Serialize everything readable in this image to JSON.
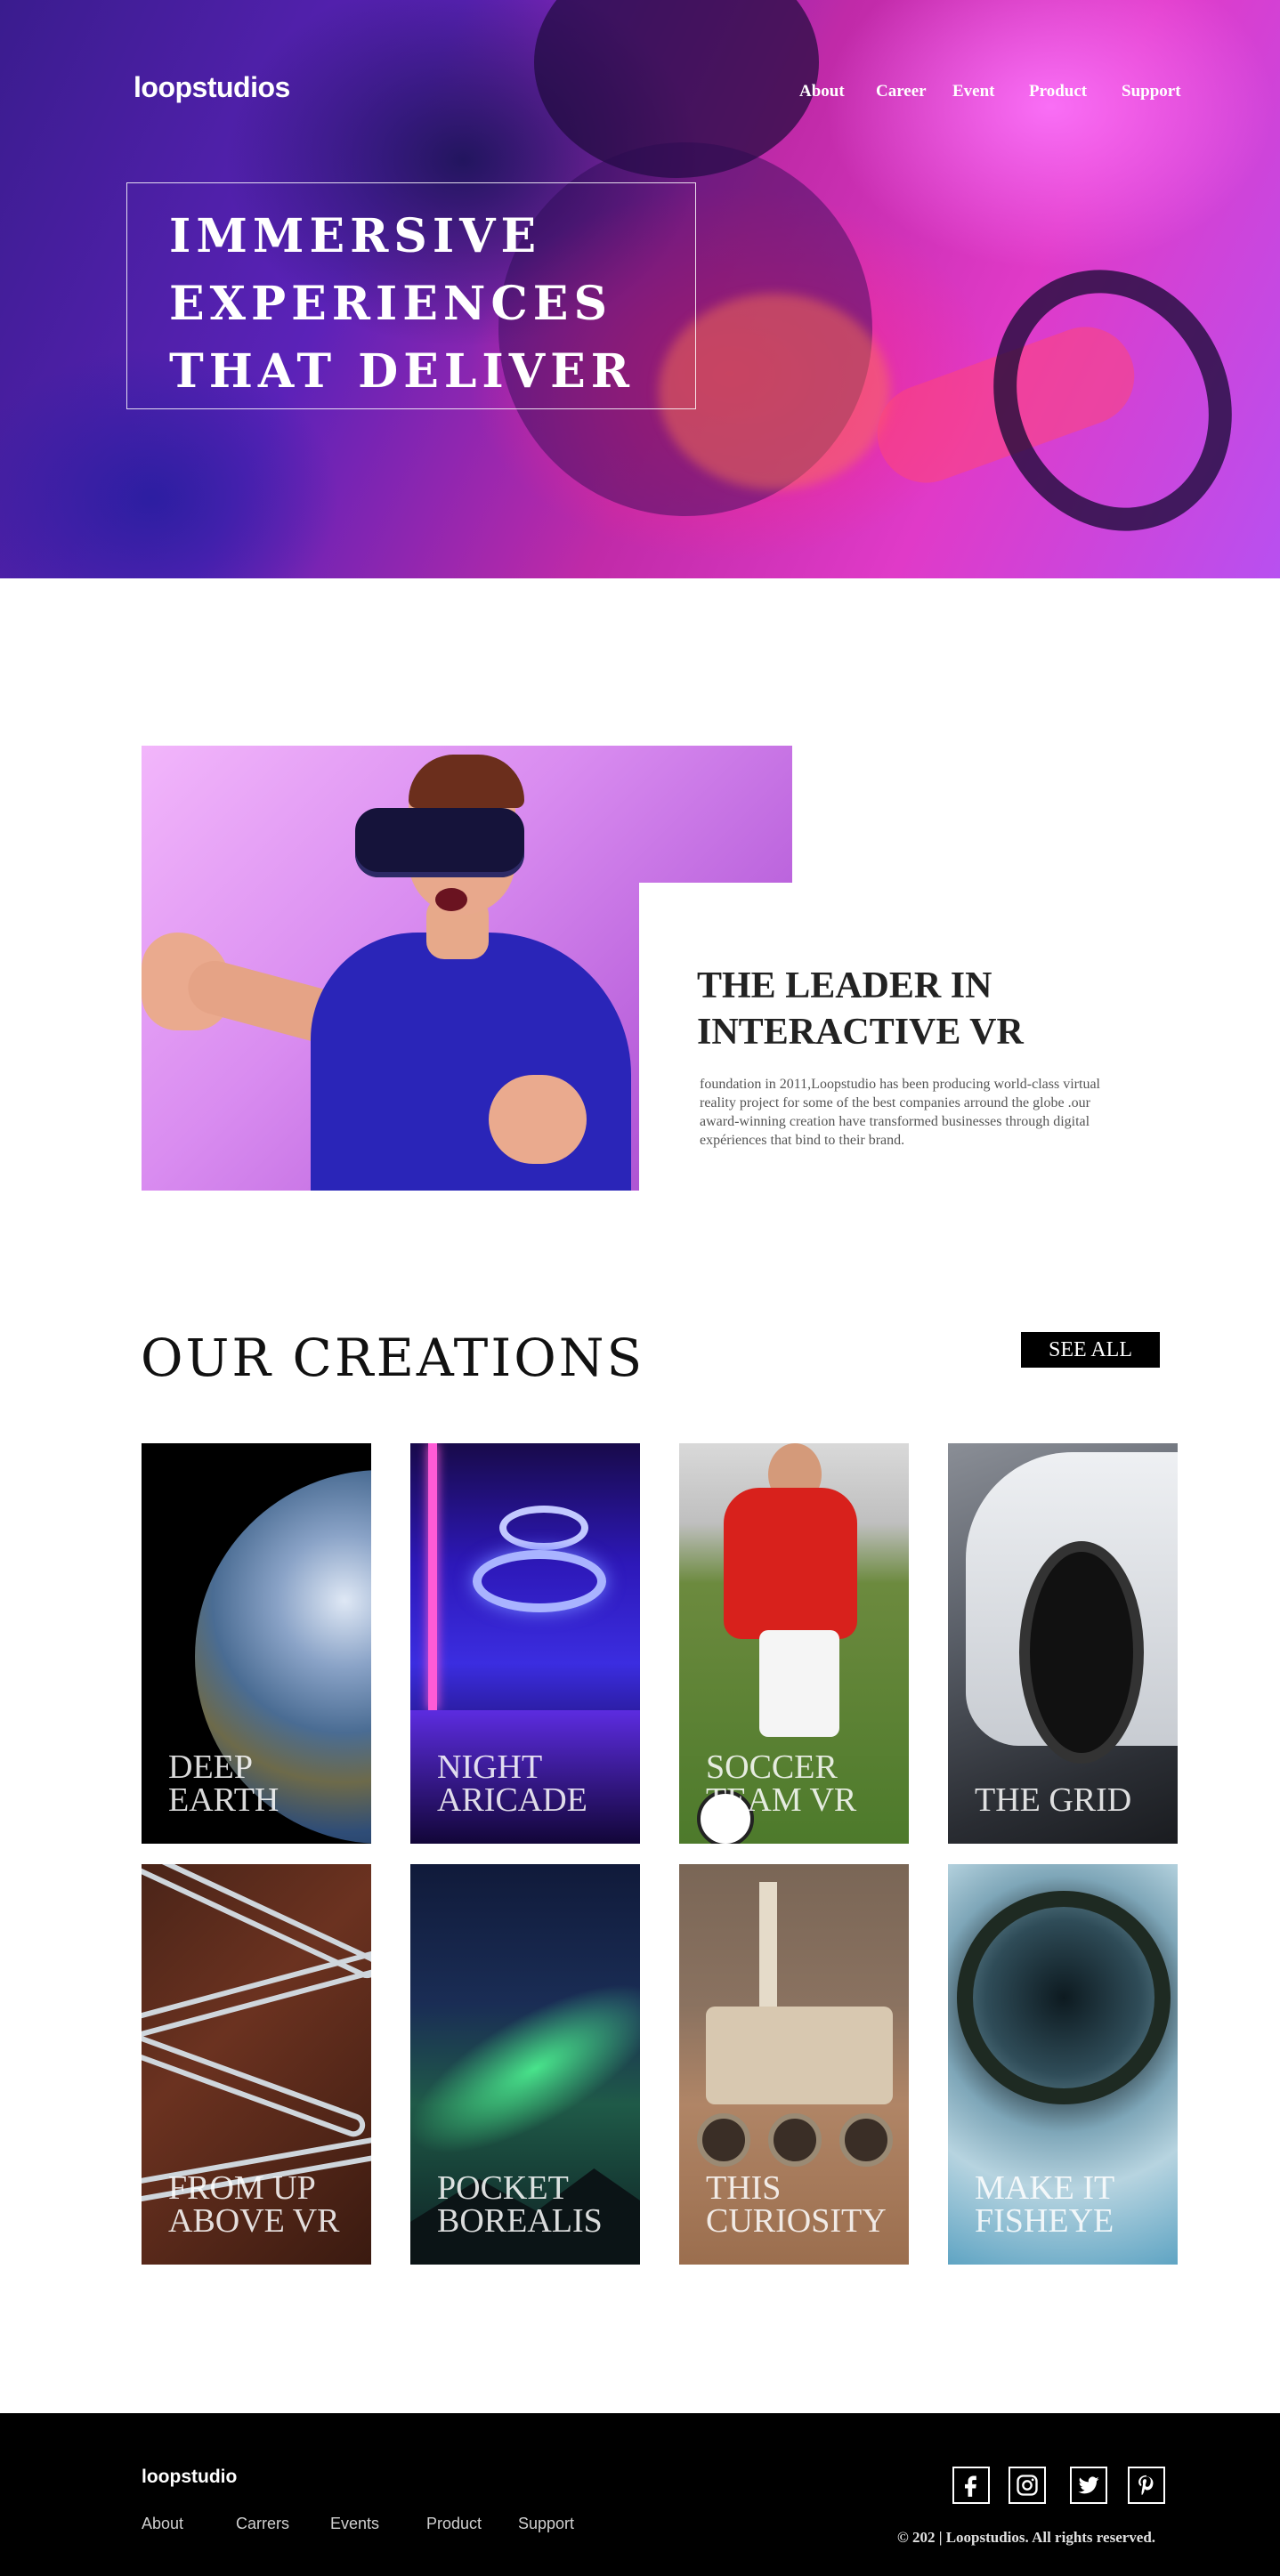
{
  "brand": {
    "logo": "loopstudios"
  },
  "nav": {
    "items": [
      "About",
      "Career",
      "Event",
      "Product",
      "Support"
    ]
  },
  "hero": {
    "title_lines": [
      "IMMERSIVE",
      "EXPERIENCES",
      "THAT DELIVER"
    ]
  },
  "about": {
    "title": "THE LEADER IN INTERACTIVE VR",
    "text": "foundation in 2011,Loopstudio has been producing world-class virtual reality project for some of the best companies arround the globe .our award-winning creation have transformed businesses through digital expériences that bind to their brand."
  },
  "creations": {
    "title": "OUR CREATIONS",
    "see_all": "SEE ALL",
    "cards": [
      {
        "label": "DEEP EARTH"
      },
      {
        "label": "NIGHT ARICADE"
      },
      {
        "label": "SOCCER TEAM VR"
      },
      {
        "label": "THE GRID"
      },
      {
        "label": "FROM UP ABOVE VR"
      },
      {
        "label": "POCKET BOREALIS"
      },
      {
        "label": "THIS CURIOSITY"
      },
      {
        "label": "MAKE IT FISHEYE"
      }
    ]
  },
  "footer": {
    "logo": "loopstudio",
    "nav": [
      "About",
      "Carrers",
      "Events",
      "Product",
      "Support"
    ],
    "social": [
      "facebook-icon",
      "instagram-icon",
      "twitter-icon",
      "pinterest-icon"
    ],
    "copyright": "© 202 | Loopstudios. All rights reserved."
  },
  "colors": {
    "hero_magenta": "#e03ac8",
    "hero_purple": "#5b22b8",
    "footer_bg": "#000000",
    "button_bg": "#000000"
  }
}
